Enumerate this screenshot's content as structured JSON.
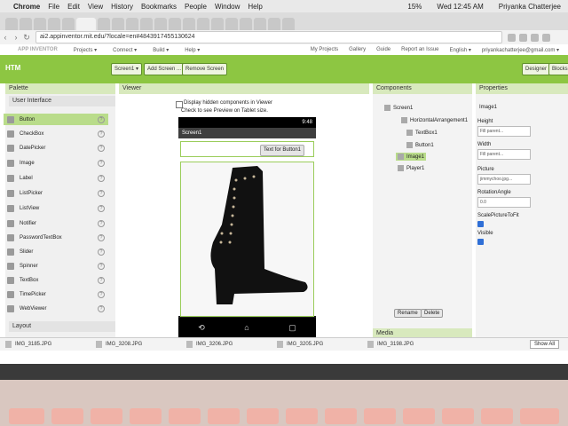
{
  "mac": {
    "app": "Chrome",
    "menus": [
      "File",
      "Edit",
      "View",
      "History",
      "Bookmarks",
      "People",
      "Window",
      "Help"
    ],
    "battery": "15%",
    "time": "Wed 12:45 AM",
    "user": "Priyanka Chatterjee"
  },
  "browser": {
    "url": "ai2.appinventor.mit.edu/?locale=en#4843917455130624"
  },
  "ai": {
    "logo": "APP INVENTOR",
    "menus": [
      "Projects ▾",
      "Connect ▾",
      "Build ▾",
      "Help ▾"
    ],
    "right": [
      "My Projects",
      "Gallery",
      "Guide",
      "Report an Issue",
      "English ▾",
      "priyankachatterjee@gmail.com ▾"
    ]
  },
  "toolbar": {
    "project": "HTM",
    "screen": "Screen1 ▾",
    "add_screen": "Add Screen ...",
    "remove_screen": "Remove Screen",
    "designer": "Designer",
    "blocks": "Blocks"
  },
  "palette": {
    "title": "Palette",
    "section": "User Interface",
    "items": [
      "Button",
      "CheckBox",
      "DatePicker",
      "Image",
      "Label",
      "ListPicker",
      "ListView",
      "Notifier",
      "PasswordTextBox",
      "Slider",
      "Spinner",
      "TextBox",
      "TimePicker",
      "WebViewer"
    ],
    "layout": "Layout"
  },
  "viewer": {
    "title": "Viewer",
    "hidden_label": "Display hidden components in Viewer",
    "preview_label": "Check to see Preview on Tablet size.",
    "time": "9:48",
    "screen_title": "Screen1",
    "button_text": "Text for Button1"
  },
  "components": {
    "title": "Components",
    "items": [
      "Screen1",
      "HorizontalArrangement1",
      "TextBox1",
      "Button1",
      "Image1",
      "Player1"
    ],
    "rename": "Rename",
    "delete": "Delete",
    "media": "Media"
  },
  "properties": {
    "title": "Properties",
    "component": "Image1",
    "height_label": "Height",
    "height_value": "Fill parent...",
    "width_label": "Width",
    "width_value": "Fill parent...",
    "picture_label": "Picture",
    "picture_value": "jimmychoo.jpg...",
    "rotation_label": "RotationAngle",
    "rotation_value": "0.0",
    "scale_label": "ScalePictureToFit",
    "visible_label": "Visible"
  },
  "downloads": {
    "files": [
      "IMG_3185.JPG",
      "IMG_3208.JPG",
      "IMG_3206.JPG",
      "IMG_3205.JPG",
      "IMG_3198.JPG"
    ],
    "show_all": "Show All"
  }
}
